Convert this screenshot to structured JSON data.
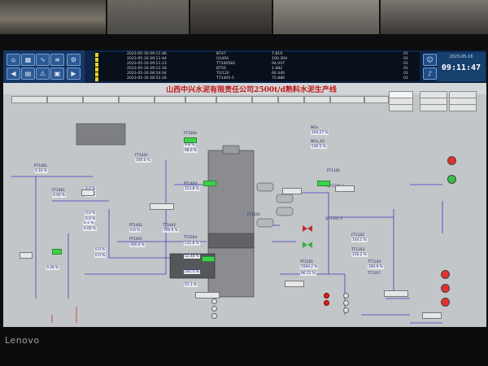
{
  "alarms": [
    {
      "time": "2023-05-16 09:11:46",
      "tag": "BT47",
      "value": "7.810",
      "desc": "",
      "pri": "01"
    },
    {
      "time": "2023-05-16 09:11:44",
      "tag": "U2404",
      "value": "100.394",
      "desc": "",
      "pri": "01"
    },
    {
      "time": "2023-05-16 09:11:23",
      "tag": "TT3405B2",
      "value": "94.047",
      "desc": "",
      "pri": "01"
    },
    {
      "time": "2023-05-16 09:11:18",
      "tag": "BT50",
      "value": "1.082",
      "desc": "",
      "pri": "01"
    },
    {
      "time": "2023-05-16 08:54:04",
      "tag": "TI2120",
      "value": "66.440",
      "desc": "",
      "pri": "01"
    },
    {
      "time": "2023-05-16 08:52:26",
      "tag": "TT3405-5",
      "value": "75.886",
      "desc": "",
      "pri": "01"
    }
  ],
  "clock": {
    "date": "2023-05-16",
    "time": "09:11:47"
  },
  "title": "山西中兴水泥有限责任公司2500t/d熟料水泥生产线",
  "tabs": [
    "",
    "",
    " ",
    "",
    "",
    "",
    "",
    "",
    "",
    "",
    "",
    "",
    "",
    "",
    "",
    "",
    "",
    "",
    "",
    "",
    "",
    ""
  ],
  "panel": {
    "corner_label_a": "",
    "corner_label_b": "",
    "labels": {
      "pt1001": "PT1001",
      "ft1001": "FT1001",
      "pt1402": "PT1402",
      "tt1402": "TT1402",
      "pt1401": "PT1401",
      "ft1401": "FT1401",
      "pt1404": "PT1404",
      "ft1004": "FT1004",
      "tt1004": "TT1004",
      "ft1101": "FT1101",
      "nox": "NOx",
      "nox2": "NOx_A2",
      "pt1101": "PT1101",
      "tt1101": "TT1101",
      "qf1101_1": "QF1101-1",
      "qf1101_2": "QF1101-2",
      "ft1102": "FT1102",
      "tt1103": "TT1103",
      "pt1201": "PT1201",
      "tt1104": "TT1104",
      "tt1107": "TT1107"
    },
    "values": {
      "v1": "100.0 %",
      "v2": "0.0 %",
      "v3": "0.0 %",
      "v4": "0.0 %",
      "v5": "0.0 %",
      "v6": "0.0 %",
      "v7": "0.0 %",
      "v8": "0.0 %",
      "v9": "0.10 %",
      "v10": "0.00 %",
      "v11": "0.1 %",
      "v12": "0.00 %",
      "v13": "0.28 %",
      "v14": "500.0 %",
      "v15": "300.0 %",
      "v16": "153.8 %",
      "v17": "9.8 %",
      "v18": "98.0 %",
      "v19": "531.8 %",
      "v20": "52.48 %",
      "v21": "501.5 %",
      "v22": "51.1 %",
      "v23": "104.27 %",
      "v24": "530.5 %",
      "v25": "5594.2 %",
      "v26": "86.21 %",
      "v27": "300.9 %",
      "v28": "156.2 %",
      "v29": "144.1 %"
    },
    "buttons": {
      "b1": "",
      "b2": "",
      "b3": "",
      "b4": "",
      "b5": "",
      "b6": "",
      "b7": "",
      "b8": "",
      "b9": ""
    },
    "bottom_labels": {
      "l1": "",
      "l2": "",
      "l3": "",
      "l4": "",
      "l5": ""
    },
    "tower_label": ""
  },
  "brand": "Lenovo"
}
